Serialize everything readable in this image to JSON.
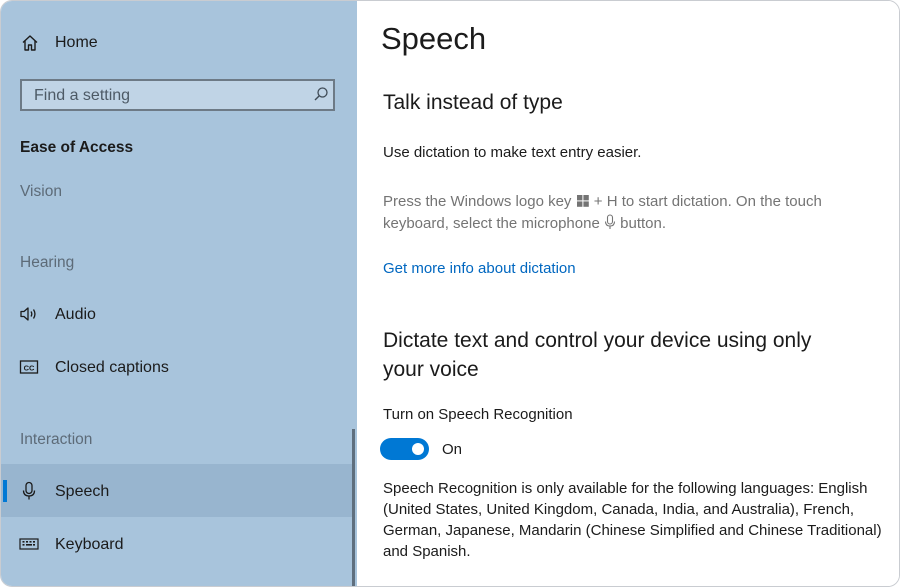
{
  "sidebar": {
    "home_label": "Home",
    "search": {
      "placeholder": "Find a setting"
    },
    "section_title": "Ease of Access",
    "groups": {
      "vision": "Vision",
      "hearing": "Hearing",
      "interaction": "Interaction"
    },
    "items": {
      "audio": "Audio",
      "closed_captions": "Closed captions",
      "speech": "Speech",
      "keyboard": "Keyboard"
    },
    "selected_item": "Speech"
  },
  "content": {
    "title": "Speech",
    "section1": {
      "heading": "Talk instead of type",
      "description": "Use dictation to make text entry easier.",
      "hint_part1": "Press the Windows logo key",
      "hint_part2": "+ H to start dictation.  On the touch keyboard, select the microphone",
      "hint_part3": "button.",
      "link": "Get more info about dictation"
    },
    "section2": {
      "heading_line1": "Dictate text and control your device using only",
      "heading_line2": "your voice",
      "toggle_label": "Turn on Speech Recognition",
      "toggle_state": "On",
      "toggle_on": true,
      "note": "Speech Recognition is only available for the following languages: English (United States, United Kingdom, Canada, India, and Australia), French, German, Japanese, Mandarin (Chinese Simplified and Chinese Traditional) and Spanish."
    }
  },
  "colors": {
    "sidebar_bg": "#a8c4dc",
    "accent": "#0078d4",
    "link": "#0067c0"
  },
  "icons": [
    "home-icon",
    "search-icon",
    "audio-icon",
    "closed-captions-icon",
    "microphone-icon",
    "keyboard-icon",
    "windows-logo-icon"
  ]
}
